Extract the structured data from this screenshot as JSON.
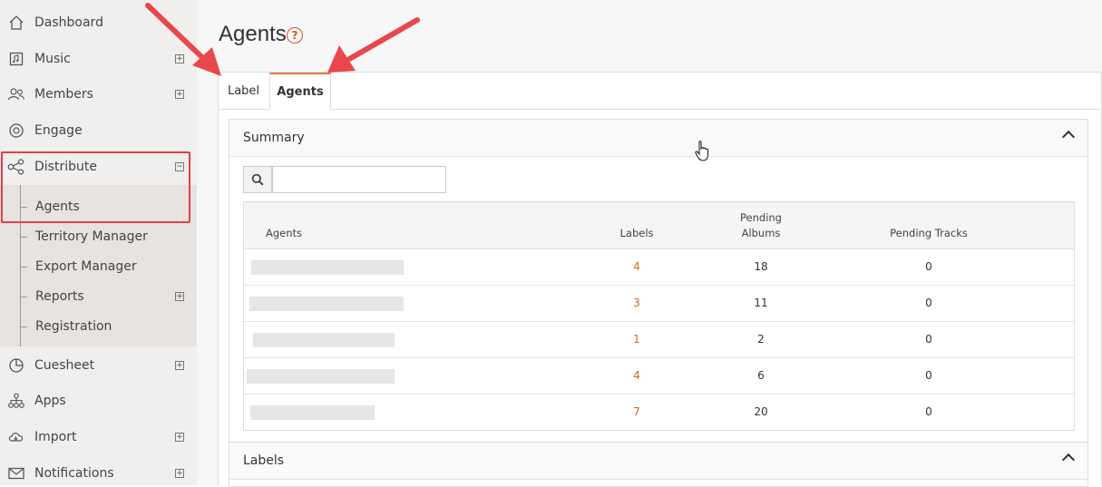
{
  "sidebar": {
    "items": [
      {
        "label": "Dashboard",
        "icon": "home-icon",
        "expand": ""
      },
      {
        "label": "Music",
        "icon": "music-icon",
        "expand": "+"
      },
      {
        "label": "Members",
        "icon": "members-icon",
        "expand": "+"
      },
      {
        "label": "Engage",
        "icon": "engage-icon",
        "expand": ""
      },
      {
        "label": "Distribute",
        "icon": "share-icon",
        "expand": "−"
      },
      {
        "label": "Cuesheet",
        "icon": "pie-chart-icon",
        "expand": "+"
      },
      {
        "label": "Apps",
        "icon": "apps-icon",
        "expand": ""
      },
      {
        "label": "Import",
        "icon": "cloud-import-icon",
        "expand": "+"
      },
      {
        "label": "Notifications",
        "icon": "mail-icon",
        "expand": "+"
      }
    ],
    "submenu": [
      {
        "label": "Agents",
        "expand": ""
      },
      {
        "label": "Territory Manager",
        "expand": ""
      },
      {
        "label": "Export Manager",
        "expand": ""
      },
      {
        "label": "Reports",
        "expand": "+"
      },
      {
        "label": "Registration",
        "expand": ""
      }
    ]
  },
  "page": {
    "title": "Agents",
    "help_glyph": "?"
  },
  "tabs": [
    {
      "label": "Label"
    },
    {
      "label": "Agents"
    }
  ],
  "summary": {
    "title": "Summary",
    "columns": {
      "agents": "Agents",
      "labels": "Labels",
      "pending_albums_1": "Pending",
      "pending_albums_2": "Albums",
      "pending_tracks": "Pending Tracks"
    },
    "rows": [
      {
        "labels": "4",
        "pending_albums": "18",
        "pending_tracks": "0"
      },
      {
        "labels": "3",
        "pending_albums": "11",
        "pending_tracks": "0"
      },
      {
        "labels": "1",
        "pending_albums": "2",
        "pending_tracks": "0"
      },
      {
        "labels": "4",
        "pending_albums": "6",
        "pending_tracks": "0"
      },
      {
        "labels": "7",
        "pending_albums": "20",
        "pending_tracks": "0"
      }
    ]
  },
  "labels_panel": {
    "title": "Labels"
  },
  "colors": {
    "accent": "#d9532f",
    "link": "#d2691e",
    "highlight": "#e0404a",
    "arrow": "#e8474c"
  }
}
